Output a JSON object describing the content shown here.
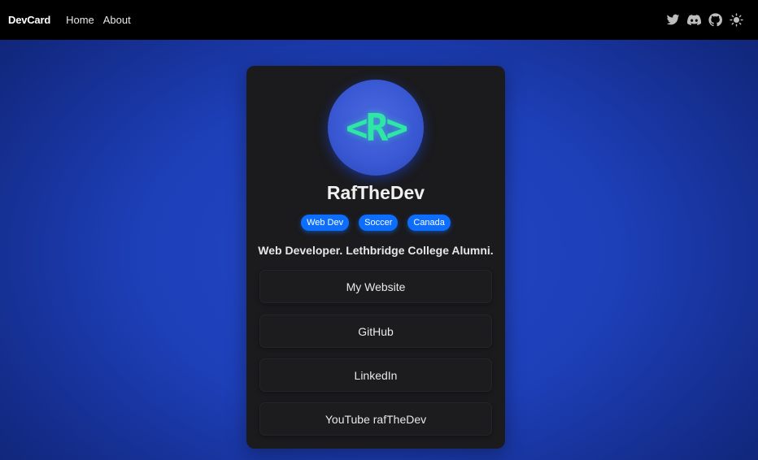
{
  "navbar": {
    "brand": "DevCard",
    "links": [
      "Home",
      "About"
    ],
    "icons": [
      "twitter-icon",
      "discord-icon",
      "github-icon",
      "sun-icon"
    ]
  },
  "profile": {
    "avatar_text": "<R>",
    "name": "RafTheDev",
    "tags": [
      "Web Dev",
      "Soccer",
      "Canada"
    ],
    "bio": "Web Developer. Lethbridge College Alumni."
  },
  "links": [
    {
      "label": "My Website"
    },
    {
      "label": "GitHub"
    },
    {
      "label": "LinkedIn"
    },
    {
      "label": "YouTube rafTheDev"
    }
  ],
  "colors": {
    "navbar_bg": "#000000",
    "page_bg": "#1d3fb8",
    "card_bg": "#1b1b1e",
    "tag_bg": "#0d6efd",
    "avatar_text": "#2ee6a6",
    "avatar_bg": "#3a59d4"
  }
}
